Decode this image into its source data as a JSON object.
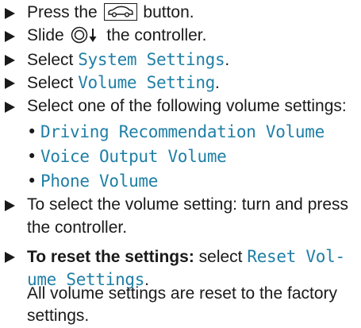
{
  "steps": [
    {
      "prefix": "Press the",
      "icon": "car-button-icon",
      "suffix": "button."
    },
    {
      "prefix": "Slide",
      "icon": "controller-slide-down-icon",
      "suffix": "the controller."
    },
    {
      "prefix": "Select",
      "menu": "System Settings",
      "suffix": "."
    },
    {
      "prefix": "Select",
      "menu": "Volume Setting",
      "suffix": "."
    },
    {
      "text": "Select one of the following volume settings:"
    },
    {
      "text_line1": "To select the volume setting: turn and press",
      "text_line2": "the controller."
    },
    {
      "bold": "To reset the settings:",
      "prefix": "select",
      "menu_line1": "Reset Vol-",
      "menu_line2": "ume Settings",
      "suffix": ".",
      "result_line1": "All volume settings are reset to the factory",
      "result_line2": "settings."
    }
  ],
  "options": [
    "Driving Recommendation Volume",
    "Voice Output Volume",
    "Phone Volume"
  ],
  "colors": {
    "text": "#1a1a1a",
    "menu": "#1f7fa6"
  }
}
